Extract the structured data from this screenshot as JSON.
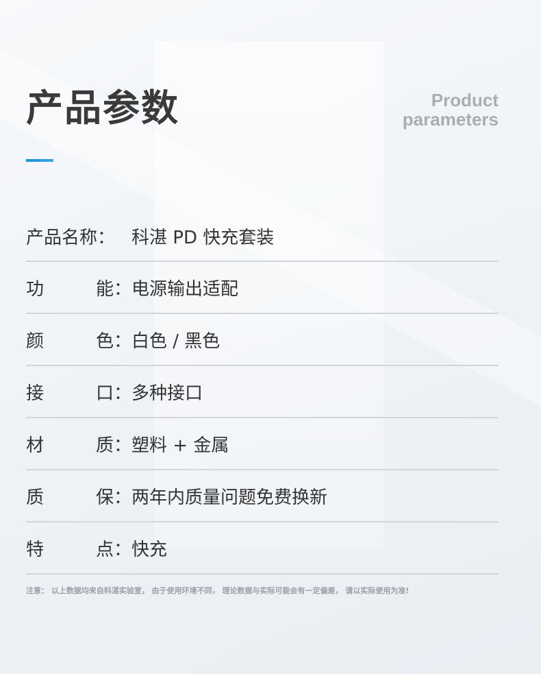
{
  "header": {
    "title": "产品参数",
    "subtitle_line1": "Product",
    "subtitle_line2": "parameters"
  },
  "params": [
    {
      "label_a": "产品名称：",
      "label_b": "",
      "value": "科湛 PD 快充套装"
    },
    {
      "label_a": "功",
      "label_b": "能：",
      "value": "电源输出适配"
    },
    {
      "label_a": "颜",
      "label_b": "色：",
      "value": "白色 / 黑色"
    },
    {
      "label_a": "接",
      "label_b": "口：",
      "value": "多种接口"
    },
    {
      "label_a": "材",
      "label_b": "质：",
      "value": "塑料 + 金属"
    },
    {
      "label_a": "质",
      "label_b": "保：",
      "value": "两年内质量问题免费换新"
    },
    {
      "label_a": "特",
      "label_b": "点：",
      "value": "快充"
    }
  ],
  "note": "注意：  以上数据均来自科湛实验室，  由于使用环境不同，  理论数据与实际可能会有一定偏差，  请以实际使用为准!",
  "colors": {
    "accent": "#1a8fd6",
    "title": "#3a3a3a",
    "subtitle": "#a8adb3",
    "divider": "#d2d6da"
  }
}
